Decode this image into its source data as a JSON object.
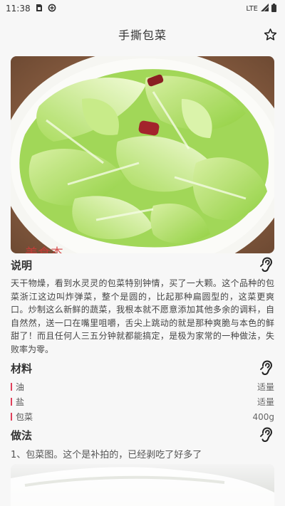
{
  "status_bar": {
    "time": "11:38",
    "network": "LTE"
  },
  "header": {
    "title": "手撕包菜"
  },
  "hero_image": {
    "name": "shredded-cabbage-dish",
    "watermark": "美食杰"
  },
  "description": {
    "title": "说明",
    "text": "天干物燥，看到水灵灵的包菜特别钟情，买了一大颗。这个品种的包菜浙江这边叫炸弹菜，整个是圆的，比起那种扁圆型的，这菜更爽口。炒制这么新鲜的蔬菜，我根本就不愿意添加其他多余的调料，自自然然，送一口在嘴里咀嚼，舌尖上跳动的就是那种爽脆与本色的鲜甜了！而且任何人三五分钟就都能搞定，是极为家常的一种做法，失败率为零。"
  },
  "ingredients": {
    "title": "材料",
    "accent_color": "#e0405a",
    "items": [
      {
        "name": "油",
        "amount": "适量"
      },
      {
        "name": "盐",
        "amount": "适量"
      },
      {
        "name": "包菜",
        "amount": "400g"
      }
    ]
  },
  "method": {
    "title": "做法",
    "steps": [
      {
        "text": "1、包菜图。这个是补拍的，已经剥吃了好多了"
      }
    ]
  }
}
